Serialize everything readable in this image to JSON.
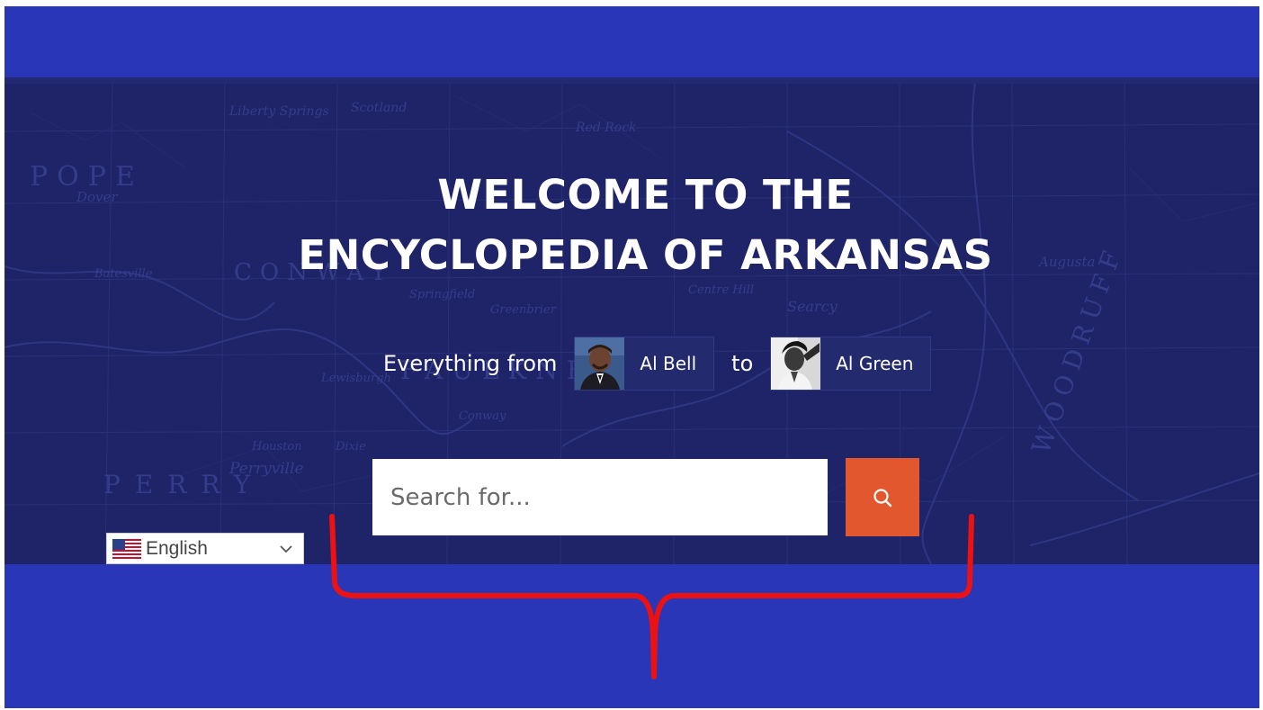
{
  "hero": {
    "title_line1": "WELCOME TO THE",
    "title_line2": "ENCYCLOPEDIA OF ARKANSAS",
    "tagline_prefix": "Everything from",
    "tagline_connector": "to",
    "person_from": {
      "name": "Al Bell",
      "icon": "al-bell-photo"
    },
    "person_to": {
      "name": "Al Green",
      "icon": "al-green-photo"
    }
  },
  "search": {
    "placeholder": "Search for...",
    "button_icon": "search-icon"
  },
  "language": {
    "selected": "English",
    "flag_icon": "us-flag-icon",
    "chevron_icon": "chevron-down-icon"
  },
  "map_labels": [
    "POPE",
    "Dover",
    "CONWAY",
    "FAULKNER",
    "PERRY",
    "Perryville",
    "Searcy",
    "WOODRUFF",
    "Augusta",
    "Liberty Springs",
    "Scotland",
    "Springfield",
    "Lewisburgh",
    "Conway",
    "Centre Hill",
    "Houston",
    "Dixie",
    "Greenbrier",
    "Batesville",
    "Red Rock"
  ],
  "colors": {
    "outer_blue": "#2a36b8",
    "hero_navy": "#1f2468",
    "search_button": "#e2572e",
    "annotation_red": "#ee1111"
  }
}
